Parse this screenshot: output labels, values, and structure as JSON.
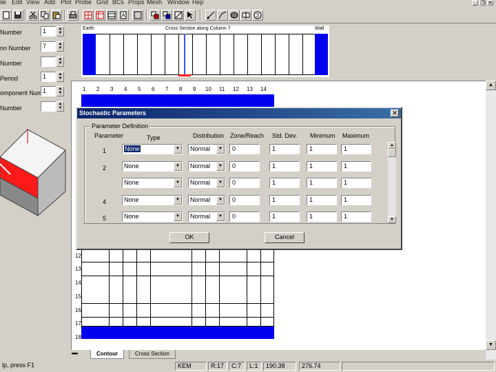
{
  "menu": [
    "ile",
    "Edit",
    "View",
    "Add",
    "Plot",
    "Probe",
    "Grid",
    "BCs",
    "Props",
    "Mesh",
    "Window",
    "Hep"
  ],
  "left_panel": {
    "labels": [
      "Number",
      "nn Number",
      "Number",
      "Period",
      "omponent Number",
      "Number"
    ],
    "values": [
      "1",
      "7",
      "",
      "1",
      "1",
      ""
    ]
  },
  "section_strip": {
    "left_label": "Earth",
    "center_label": "Cross Section along Column 7",
    "right_label": "Wall"
  },
  "grid": {
    "columns": [
      "1",
      "2",
      "3",
      "4",
      "5",
      "6",
      "7",
      "8",
      "9",
      "10",
      "11",
      "12",
      "13",
      "14"
    ],
    "rows": [
      "1",
      "12",
      "13",
      "14",
      "15",
      "16",
      "17",
      "18"
    ]
  },
  "tabs": [
    "Contour",
    "Cross Section"
  ],
  "status": {
    "hint": "lp, press F1",
    "mode": "KEM",
    "row": "R:17",
    "col": "C:7",
    "layer": "L:1",
    "x": "190.38",
    "y": "276.74"
  },
  "dialog": {
    "title": "Stochastic Parameters",
    "group_label": "Parameter Definition",
    "headers": {
      "parameter": "Parameter",
      "type": "Type",
      "distribution": "Distribution",
      "zone": "Zone/Reach",
      "stddev": "Std. Dev.",
      "minimum": "Minimum",
      "maximum": "Maximum"
    },
    "rows": [
      {
        "num": "1",
        "type": "None",
        "dist": "Normal",
        "zone": "0",
        "sd": "1",
        "min": "1",
        "max": "1"
      },
      {
        "num": "2",
        "type": "None",
        "dist": "Normal",
        "zone": "0",
        "sd": "1",
        "min": "1",
        "max": "1"
      },
      {
        "num": "",
        "type": "None",
        "dist": "Normal",
        "zone": "0",
        "sd": "1",
        "min": "1",
        "max": "1"
      },
      {
        "num": "4",
        "type": "None",
        "dist": "Normal",
        "zone": "0",
        "sd": "1",
        "min": "1",
        "max": "1"
      },
      {
        "num": "5",
        "type": "None",
        "dist": "Normal",
        "zone": "0",
        "sd": "1",
        "min": "1",
        "max": "1"
      }
    ],
    "ok_label": "OK",
    "cancel_label": "Cancel"
  },
  "colors": {
    "blue": "#0000ee",
    "red": "#ff1a1a",
    "title_bar": "#0a246a"
  }
}
